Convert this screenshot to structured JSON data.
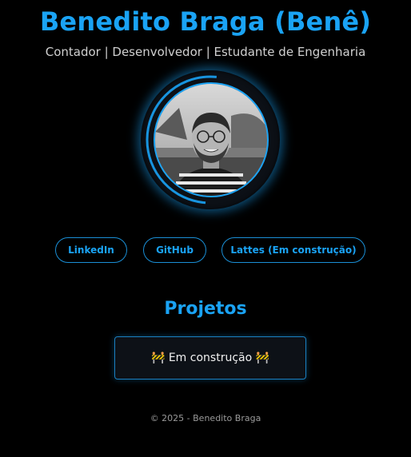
{
  "header": {
    "name": "Benedito Braga (Benê)",
    "roles": "Contador | Desenvolvedor | Estudante de Engenharia"
  },
  "profile": {
    "photo": "profile-photo",
    "ring_color": "#1aa3f5"
  },
  "links": [
    {
      "label": "LinkedIn"
    },
    {
      "label": "GitHub"
    },
    {
      "label": "Lattes (Em construção)"
    }
  ],
  "projects": {
    "title": "Projetos",
    "status": "🚧 Em construção 🚧"
  },
  "footer": {
    "copyright": "© 2025 - Benedito Braga"
  },
  "colors": {
    "accent": "#1aa3f5",
    "background": "#000000",
    "card_bg": "#0d1117"
  }
}
